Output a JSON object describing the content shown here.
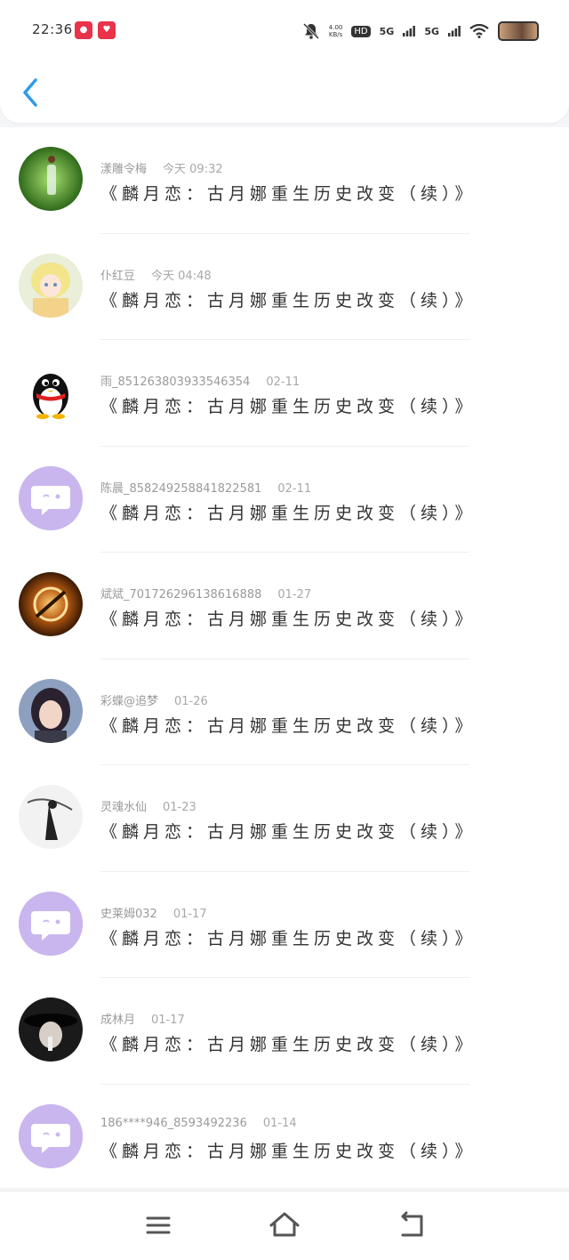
{
  "status_bar": {
    "time": "22:36",
    "network_speed": "4.00\nKB/s",
    "hd_label": "HD",
    "signal_1": "5G",
    "signal_2": "5G"
  },
  "icons": {
    "back": "chevron-left-icon",
    "menu": "menu-icon",
    "home": "home-icon",
    "return": "return-icon"
  },
  "colors": {
    "accent": "#2f9be8",
    "default_avatar": "#c9b6ee"
  },
  "comments": [
    {
      "user": "漾雕令梅",
      "time": "今天 09:32",
      "title": "《麟月恋：古月娜重生历史改变（续）》",
      "avatar": "photo-green"
    },
    {
      "user": "仆红豆",
      "time": "今天 04:48",
      "title": "《麟月恋：古月娜重生历史改变（续）》",
      "avatar": "photo-doll"
    },
    {
      "user": "雨_851263803933546354",
      "time": "02-11",
      "title": "《麟月恋：古月娜重生历史改变（续）》",
      "avatar": "qq-penguin"
    },
    {
      "user": "陈晨_858249258841822581",
      "time": "02-11",
      "title": "《麟月恋：古月娜重生历史改变（续）》",
      "avatar": "default-chat"
    },
    {
      "user": "斌斌_701726296138616888",
      "time": "01-27",
      "title": "《麟月恋：古月娜重生历史改变（续）》",
      "avatar": "photo-orb"
    },
    {
      "user": "彩蝶@追梦",
      "time": "01-26",
      "title": "《麟月恋：古月娜重生历史改变（续）》",
      "avatar": "photo-girl"
    },
    {
      "user": "灵魂水仙",
      "time": "01-23",
      "title": "《麟月恋：古月娜重生历史改变（续）》",
      "avatar": "photo-ink"
    },
    {
      "user": "史莱姆032",
      "time": "01-17",
      "title": "《麟月恋：古月娜重生历史改变（续）》",
      "avatar": "default-chat"
    },
    {
      "user": "成林月",
      "time": "01-17",
      "title": "《麟月恋：古月娜重生历史改变（续）》",
      "avatar": "photo-dark"
    },
    {
      "user": "186****946_8593492236",
      "time": "01-14",
      "title": "《麟月恋：古月娜重生历史改变（续）》",
      "avatar": "default-chat"
    }
  ]
}
